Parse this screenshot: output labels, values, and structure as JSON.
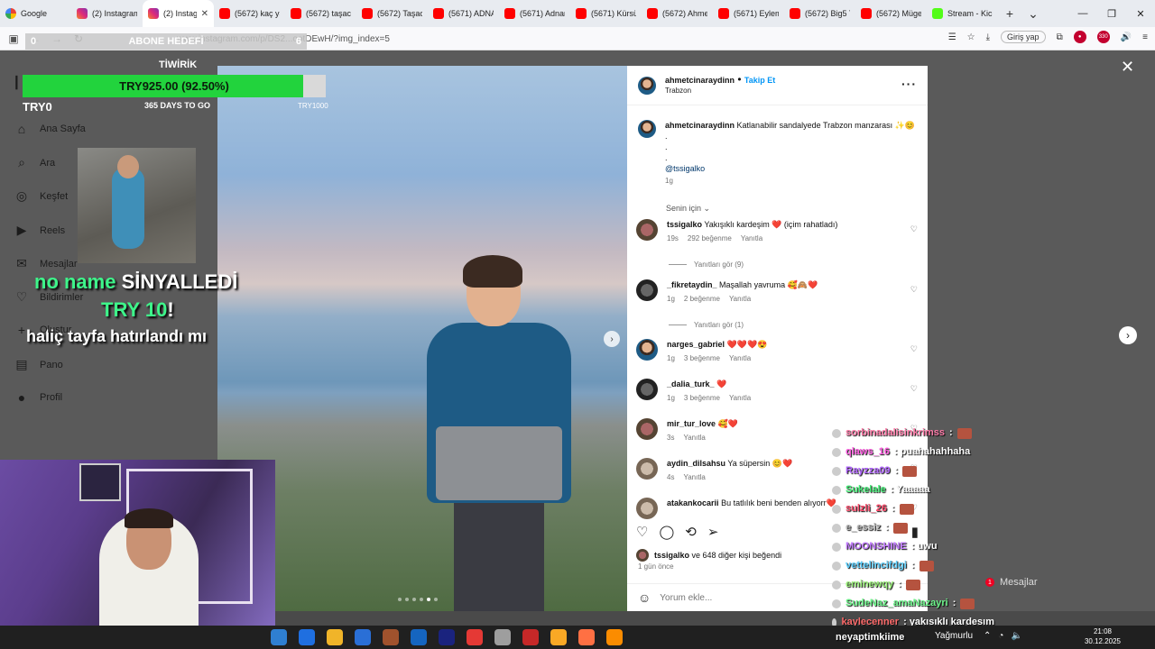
{
  "browser": {
    "tabs": [
      {
        "label": "Google",
        "icon": "google"
      },
      {
        "label": "(2) Instagram",
        "icon": "instagram"
      },
      {
        "label": "(2) Instagra",
        "icon": "instagram"
      },
      {
        "label": "(5672) kaç yaş",
        "icon": "youtube"
      },
      {
        "label": "(5672) taşacak",
        "icon": "youtube"
      },
      {
        "label": "(5672) Taşacak",
        "icon": "youtube"
      },
      {
        "label": "(5671) ADNAN",
        "icon": "youtube"
      },
      {
        "label": "(5671) Adnan",
        "icon": "youtube"
      },
      {
        "label": "(5671) Kürsü",
        "icon": "youtube"
      },
      {
        "label": "(5672) Ahmet",
        "icon": "youtube"
      },
      {
        "label": "(5671) Eylem",
        "icon": "youtube"
      },
      {
        "label": "(5672) Big5 Tü",
        "icon": "youtube"
      },
      {
        "label": "(5672) Müge",
        "icon": "youtube"
      },
      {
        "label": "Stream - Kick",
        "icon": "kick"
      }
    ],
    "url": "www.instagram.com/p/DS2...ootDEwH/?img_index=5",
    "signin": "Giriş yap",
    "badge_count": "330"
  },
  "sidebar": {
    "items": [
      {
        "label": "Ana Sayfa",
        "icon": "home-icon"
      },
      {
        "label": "Ara",
        "icon": "search-icon"
      },
      {
        "label": "Keşfet",
        "icon": "compass-icon"
      },
      {
        "label": "Reels",
        "icon": "reels-icon"
      },
      {
        "label": "Mesajlar",
        "icon": "messenger-icon"
      },
      {
        "label": "Bildirimler",
        "icon": "heart-icon"
      },
      {
        "label": "Oluştur",
        "icon": "plus-icon"
      },
      {
        "label": "Pano",
        "icon": "dashboard-icon"
      },
      {
        "label": "Profil",
        "icon": "profile-icon"
      }
    ]
  },
  "post": {
    "username": "ahmetcinaraydinn",
    "follow": "Takip Et",
    "location": "Trabzon",
    "caption": "Katlanabilir sandalyede Trabzon manzarası ✨😊",
    "caption_dots": [
      ".",
      ".",
      "."
    ],
    "mention": "@tssigalko",
    "caption_time": "1g",
    "for_you": "Senin için ⌄",
    "comments": [
      {
        "user": "tssigalko",
        "text": "Yakışıklı kardeşim ❤️ (içim rahatladı)",
        "time": "19s",
        "likes": "292 beğenme",
        "reply": "Yanıtla",
        "replies": "Yanıtları gör (9)"
      },
      {
        "user": "_fikretaydin_",
        "text": "Maşallah yavruma 🥰🙈❤️",
        "time": "1g",
        "likes": "2 beğenme",
        "reply": "Yanıtla",
        "replies": "Yanıtları gör (1)"
      },
      {
        "user": "narges_gabriel",
        "text": "❤️❤️❤️😍",
        "time": "1g",
        "likes": "3 beğenme",
        "reply": "Yanıtla"
      },
      {
        "user": "_dalia_turk_",
        "text": "❤️",
        "time": "1g",
        "likes": "3 beğenme",
        "reply": "Yanıtla"
      },
      {
        "user": "mir_tur_love",
        "text": "🥰❤️",
        "time": "3s",
        "reply": "Yanıtla"
      },
      {
        "user": "aydin_dilsahsu",
        "text": "Ya süpersin 😊❤️",
        "time": "4s",
        "reply": "Yanıtla"
      },
      {
        "user": "atakankocarii",
        "text": "Bu tatlılık beni benden alıyorr❤️"
      }
    ],
    "liked_by_user": "tssigalko",
    "liked_by_rest": " ve 648 diğer kişi beğendi",
    "posted": "1 gün önce",
    "add_comment": "Yorum ekle..."
  },
  "overlay": {
    "sub_goal_label": "ABONE HEDEFİ",
    "sub_goal_left": "0",
    "sub_goal_right": "6",
    "tip_title": "TİWİRİK",
    "tip_text": "TRY925.00 (92.50%)",
    "tip_progress": 0.925,
    "tip_min": "TRY0",
    "tip_days": "365 DAYS TO GO",
    "tip_max": "TRY1000",
    "alert_name": "no name",
    "alert_action": " SİNYALLEDİ",
    "alert_amount": "TRY 10",
    "alert_bang": "!",
    "alert_message": "haliç tayfa hatırlandı mı"
  },
  "chat": [
    {
      "user": "sorbinadalisinkrimss",
      "msg": ":",
      "color": "#ff7aa8"
    },
    {
      "user": "qlaws_16",
      "msg": ": puahahahhaha",
      "color": "#ff5ce1"
    },
    {
      "user": "Rayzza09",
      "msg": ":",
      "color": "#b266ff"
    },
    {
      "user": "Sukelale",
      "msg": ": Yaaaaa",
      "color": "#49f07b"
    },
    {
      "user": "sulzli_26",
      "msg": ":",
      "color": "#ff4d6d"
    },
    {
      "user": "e_essiz",
      "msg": ":",
      "color": "#bbbbbb"
    },
    {
      "user": "MOONSHINE",
      "msg": ": uwu",
      "color": "#c27bff"
    },
    {
      "user": "vettelincifdgi",
      "msg": ":",
      "color": "#5fd0ff"
    },
    {
      "user": "eminewqy",
      "msg": ":",
      "color": "#9bf27a"
    },
    {
      "user": "SudeNaz_amaNazayri",
      "msg": ":",
      "color": "#6cf58a"
    },
    {
      "user": "kaylecenner",
      "msg": ": yakısıklı kardesım",
      "color": "#ff6a6a"
    }
  ],
  "streamer_line": "neyaptimkiime",
  "weather": "Yağmurlu",
  "messages_label": "Mesajlar",
  "messages_count": "1",
  "clock": {
    "time": "21:08",
    "date": "30.12.2025"
  }
}
